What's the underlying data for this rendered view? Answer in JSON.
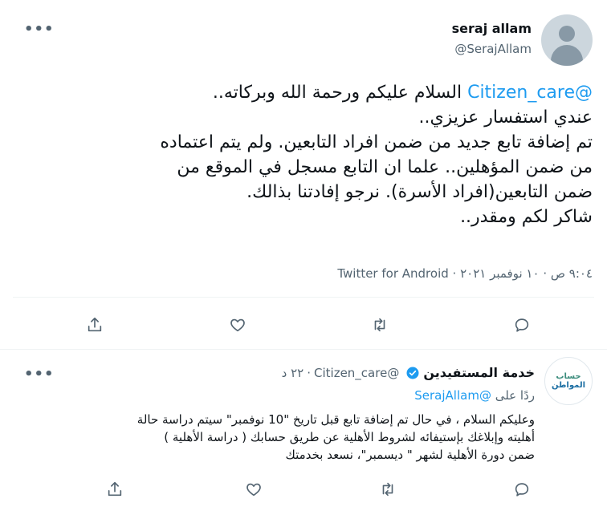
{
  "main_tweet": {
    "author_name": "seraj allam",
    "author_handle": "@SerajAllam",
    "lines": [
      {
        "mention": "@Citizen_care",
        "text": " السلام عليكم ورحمة الله وبركاته.."
      },
      {
        "mention": "",
        "text": "عندي استفسار عزيزي.."
      },
      {
        "mention": "",
        "text": "تم إضافة تابع جديد من ضمن افراد التابعين. ولم يتم اعتماده"
      },
      {
        "mention": "",
        "text": "من ضمن المؤهلين.. علما ان التابع مسجل في الموقع من"
      },
      {
        "mention": "",
        "text": "ضمن التابعين(افراد الأسرة). نرجو إفادتنا بذالك."
      },
      {
        "mention": "",
        "text": "شاكر لكم ومقدر.."
      }
    ],
    "meta": "٩:٠٤ ص · ١٠ نوفمبر ٢٠٢١ · Twitter for Android"
  },
  "reply_tweet": {
    "avatar_text_line1": "حساب",
    "avatar_text_line2": "المواطن",
    "author_name": "خدمة المستفيدين",
    "author_handle": "@Citizen_care",
    "time": "٢٢ د",
    "replying_prefix": "ردًا على",
    "replying_mention": "@SerajAllam",
    "lines": [
      "وعليكم السلام ، في حال تم إضافة تابع قبل تاريخ \"10 نوفمبر\" سيتم دراسة حالة",
      "أهليته وإبلاغك بإستيفائه لشروط الأهلية عن طريق حسابك ( دراسة الأهلية )",
      "ضمن دورة الأهلية لشهر \" ديسمبر\"، نسعد بخدمتك"
    ]
  },
  "more_label": "•••",
  "colors": {
    "accent": "#1d9bf0",
    "text": "#0f1419",
    "muted": "#536471",
    "divider": "#eff3f4"
  },
  "icons": [
    "reply-icon",
    "retweet-icon",
    "like-icon",
    "share-icon",
    "verified-badge-icon",
    "more-icon"
  ]
}
